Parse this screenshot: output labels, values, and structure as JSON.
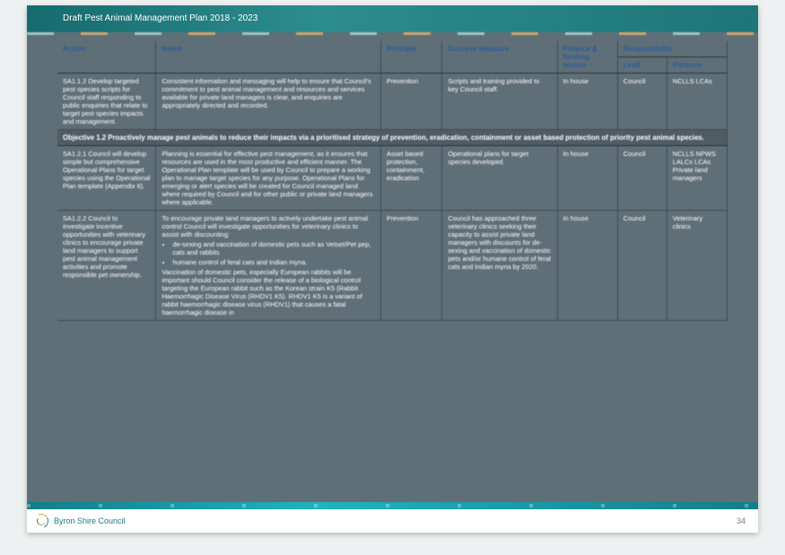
{
  "header": {
    "title": "Draft Pest Animal Management Plan 2018 - 2023"
  },
  "columns": {
    "action": "Action",
    "intent": "Intent",
    "principle": "Principle",
    "success": "Success measure",
    "finance": "Finance & funding source",
    "responsibility": "Responsibility",
    "lead": "Lead",
    "partners": "Partners"
  },
  "rows": [
    {
      "type": "data",
      "action": "SA1.1.2 Develop targeted pest species scripts for Council staff responding to public enquiries that relate to target pest species impacts and management.",
      "intent": "Consistent information and messaging will help to ensure that Council's commitment to pest animal management and resources and services available for private land managers is clear, and enquiries are appropriately directed and recorded.",
      "principle": "Prevention",
      "success": "Scripts and training provided to key Council staff.",
      "finance": "In house",
      "lead": "Council",
      "partners": "NCLLS\nLCAs"
    },
    {
      "type": "objective",
      "text": "Objective 1.2 Proactively manage pest animals to reduce their impacts via a prioritised strategy of prevention, eradication, containment or asset based protection of priority pest animal species."
    },
    {
      "type": "data",
      "action": "SA1.2.1 Council will develop simple but comprehensive Operational Plans for target species using the Operational Plan template (Appendix 6).",
      "intent": "Planning is essential for effective pest management, as it ensures that resources are used in the most productive and efficient manner. The Operational Plan template will be used by Council to prepare a working plan to manage target species for any purpose.\n\nOperational Plans for emerging or alert species will be created for Council managed land where required by Council and for other public or private land managers where applicable.",
      "principle": "Asset based protection, containment, eradication",
      "success": "Operational plans for target species developed.",
      "finance": "In house",
      "lead": "Council",
      "partners": "NCLLS\nNPWS\nLALCs\nLCAs\nPrivate land managers"
    },
    {
      "type": "data",
      "action": "SA1.2.2 Council to investigate incentive opportunities with veterinary clinics to encourage private land managers to support pest animal management activities and promote responsible pet ownership.",
      "intent_main": "To encourage private land managers to actively undertake pest animal control Council will investigate opportunities for veterinary clinics to assist with discounting:",
      "intent_bullets": [
        "de-sexing and vaccination of domestic pets such as Vetset/Pet pep, cats and rabbits",
        "humane control of feral cats and Indian myna."
      ],
      "intent_tail": "Vaccination of domestic pets, especially European rabbits will be important should Council consider the release of a biological control targeting the European rabbit such as the Korean strain K5 (Rabbit Haemorrhagic Disease Virus (RHDV1 K5). RHDV1 K5 is a variant of rabbit haemorrhagic disease virus (RHDV1) that causes a fatal haemorrhagic disease in",
      "principle": "Prevention",
      "success": "Council has approached three veterinary clinics seeking their capacity to assist private land managers with discounts for de-sexing and vaccination of domestic pets and/or humane control of feral cats and Indian myna by 2020.",
      "finance": "In house",
      "lead": "Council",
      "partners": "Veterinary clinics"
    }
  ],
  "footer": {
    "org": "Byron Shire Council",
    "page_number": "34"
  }
}
